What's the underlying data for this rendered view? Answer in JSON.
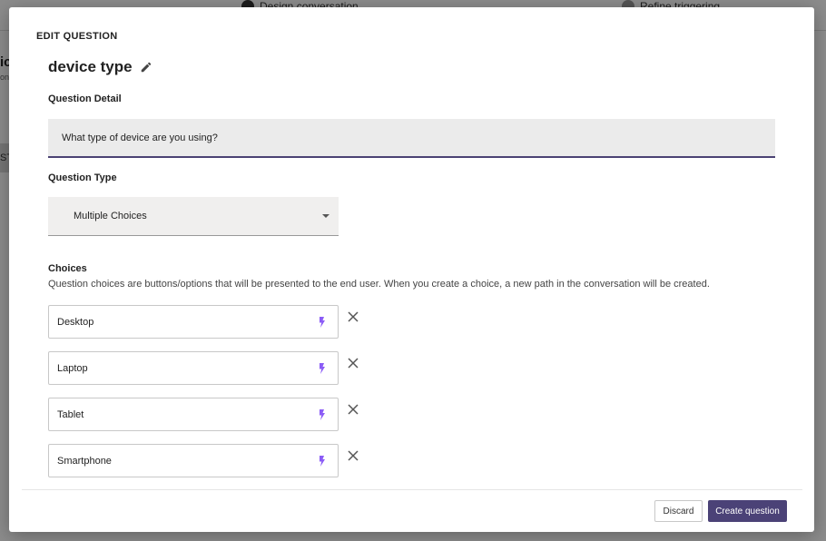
{
  "background": {
    "steps": [
      "Design conversation",
      "Refine triggering"
    ],
    "left_title": "ic",
    "left_sub": "ons",
    "left_tab": "ST"
  },
  "modal": {
    "label": "EDIT QUESTION",
    "question_name": "device type",
    "detail": {
      "label": "Question Detail",
      "value": "What type of device are you using?"
    },
    "type": {
      "label": "Question Type",
      "value": "Multiple Choices"
    },
    "choices": {
      "label": "Choices",
      "description": "Question choices are buttons/options that will be presented to the end user. When you create a choice, a new path in the conversation will be created.",
      "items": [
        "Desktop",
        "Laptop",
        "Tablet",
        "Smartphone"
      ]
    },
    "buttons": {
      "discard": "Discard",
      "create": "Create question"
    }
  },
  "colors": {
    "accent": "#4b4277",
    "bolt": "#8b5cf6"
  },
  "icons": {
    "edit": "pencil-icon",
    "choice_action": "bolt-icon",
    "remove": "close-icon",
    "dropdown": "caret-down-icon"
  }
}
